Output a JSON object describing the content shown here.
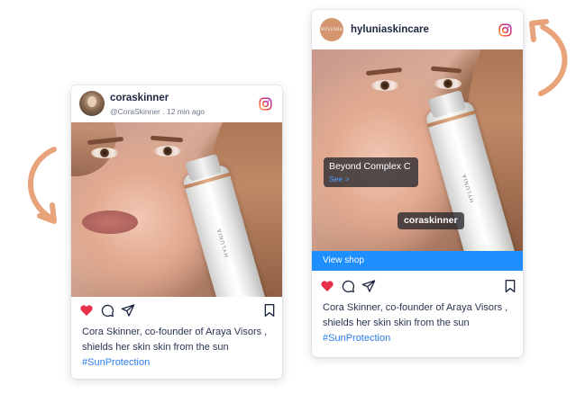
{
  "left_post": {
    "username": "coraskinner",
    "handle": "@CoraSkinner",
    "time": "12 min ago",
    "caption_text": "Cora Skinner, co-founder of Araya Visors , shields her skin skin from the sun",
    "hashtag": "#SunProtection"
  },
  "right_post": {
    "username": "hyluniaskincare",
    "avatar_text": "HYLUNIA",
    "product_tag": {
      "title": "Beyond Complex C",
      "link": "See >"
    },
    "person_tag": "coraskinner",
    "shop_label": "View shop",
    "caption_text": "Cora Skinner, co-founder of Araya Visors , shields her skin skin from the sun",
    "hashtag": "#SunProtection"
  },
  "product_brand_text": "HYLUNIA",
  "icons": {
    "platform": "instagram-icon",
    "like": "heart-icon",
    "comment": "comment-icon",
    "share": "share-icon",
    "save": "bookmark-icon",
    "arrows": "curved-arrow-icon"
  },
  "colors": {
    "like_red": "#e8304a",
    "link_blue": "#2b7de9",
    "shop_blue": "#1f8fff",
    "arrow_orange": "#e8a37a",
    "avatar_orange": "#d4956f"
  }
}
